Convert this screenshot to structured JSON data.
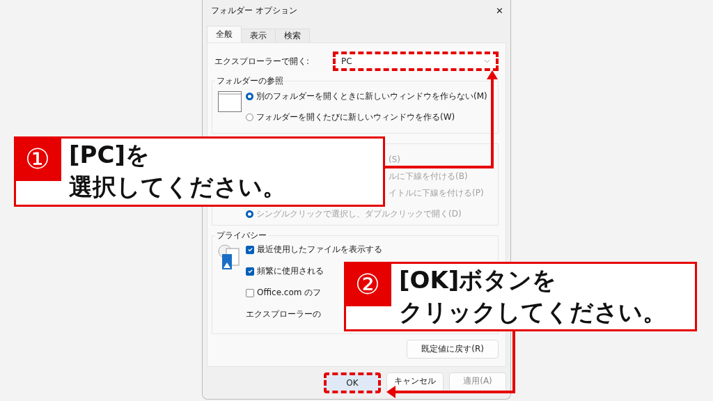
{
  "window": {
    "title": "フォルダー オプション",
    "close": "✕"
  },
  "tabs": [
    {
      "label": "全般",
      "selected": true
    },
    {
      "label": "表示",
      "selected": false
    },
    {
      "label": "検索",
      "selected": false
    }
  ],
  "open_with": {
    "label": "エクスプローラーで開く:",
    "value": "PC",
    "highlighted": true
  },
  "groups": [
    {
      "legend": "フォルダーの参照",
      "disabled": false,
      "rows": [
        {
          "kind": "radio",
          "label": "別のフォルダーを開くときに新しいウィンドウを作らない(M)",
          "selected": true
        },
        {
          "kind": "radio",
          "label": "フォルダーを開くたびに新しいウィンドウを作る(W)",
          "selected": false
        }
      ]
    },
    {
      "disabled": true,
      "rows": [
        {
          "kind": "fragment",
          "label": "(S)"
        },
        {
          "kind": "fragment",
          "label": "ルに下線を付ける(B)"
        },
        {
          "kind": "fragment",
          "label": "イトルに下線を付ける(P)"
        },
        {
          "kind": "radio",
          "label": "シングルクリックで選択し、ダブルクリックで開く(D)",
          "selected": true
        }
      ]
    },
    {
      "legend": "プライバシー",
      "disabled": false,
      "rows": [
        {
          "kind": "check",
          "label": "最近使用したファイルを表示する",
          "checked": true
        },
        {
          "kind": "check",
          "label": "頻繁に使用される",
          "checked": true
        },
        {
          "kind": "check",
          "label": "Office.com のフ",
          "checked": false
        },
        {
          "kind": "text",
          "label": "エクスプローラーの"
        }
      ]
    }
  ],
  "reset_button": "既定値に戻す(R)",
  "buttons": [
    {
      "label": "OK",
      "highlighted": true,
      "disabled": false
    },
    {
      "label": "キャンセル",
      "highlighted": false,
      "disabled": false
    },
    {
      "label": "適用(A)",
      "highlighted": false,
      "disabled": true
    }
  ],
  "callouts": [
    {
      "number": "①",
      "lines": [
        "[PC]を",
        "選択してください。"
      ]
    },
    {
      "number": "②",
      "lines": [
        "[OK]ボタンを",
        "クリックしてください。"
      ]
    }
  ]
}
